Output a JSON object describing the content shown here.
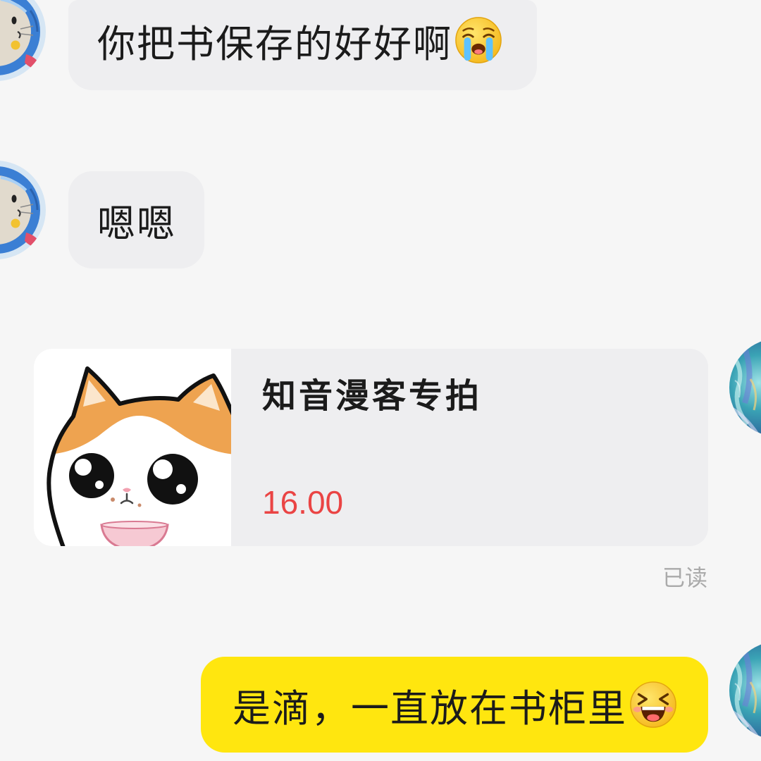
{
  "messages": [
    {
      "text": "你把书保存的好好啊",
      "emoji": "loudly-crying-face-icon",
      "avatar": "cat-avatar-icon"
    },
    {
      "text": "嗯嗯",
      "avatar": "cat-avatar-icon"
    },
    {
      "product": {
        "title": "知音漫客专拍",
        "price": "16.00",
        "image": "cat-sticker-image"
      },
      "read_status": "已读",
      "avatar": "anime-avatar-icon"
    },
    {
      "text": "是滴，一直放在书柜里",
      "emoji": "laughing-face-icon",
      "avatar": "anime-avatar-icon"
    }
  ],
  "colors": {
    "background": "#f6f6f6",
    "incoming_bubble": "#eeeef0",
    "outgoing_bubble": "#ffe60f",
    "product_card": "#eeeef0",
    "price": "#ea4444",
    "read_status": "#aaaaaa",
    "text": "#1b1b1b"
  }
}
